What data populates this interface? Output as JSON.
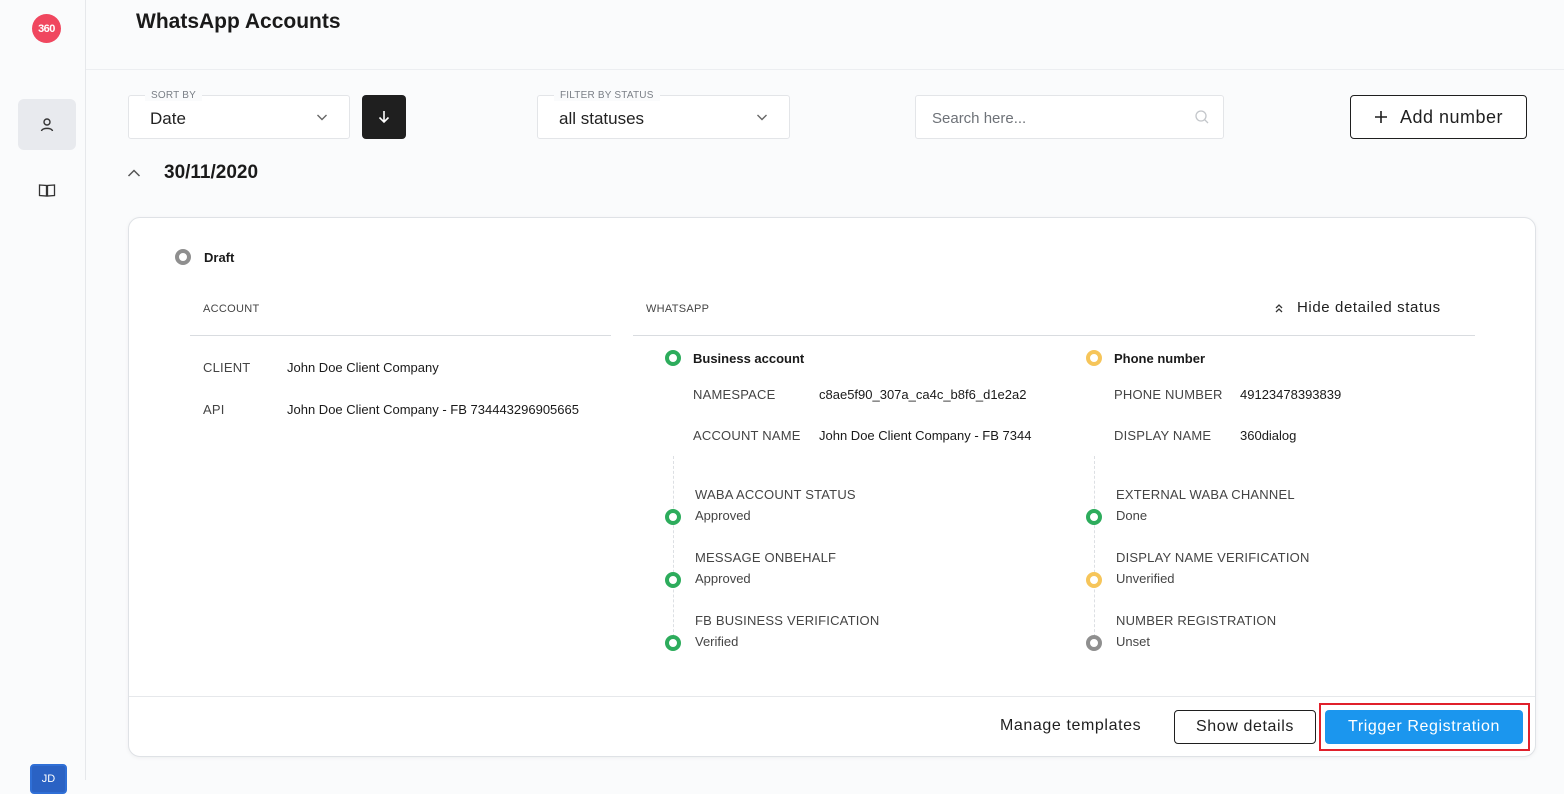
{
  "sidebar": {
    "logo": "360",
    "items": [
      {
        "name": "accounts",
        "icon": "user-icon",
        "active": true
      },
      {
        "name": "docs",
        "icon": "book-icon",
        "active": false
      }
    ],
    "avatar": "JD"
  },
  "header": {
    "title": "WhatsApp Accounts"
  },
  "filters": {
    "sort_label": "SORT BY",
    "sort_value": "Date",
    "status_label": "FILTER BY STATUS",
    "status_value": "all statuses",
    "search_placeholder": "Search here...",
    "add_number": "Add number"
  },
  "group": {
    "date": "30/11/2020"
  },
  "card": {
    "status": "Draft",
    "account": {
      "header": "ACCOUNT",
      "rows": [
        {
          "label": "CLIENT",
          "value": "John Doe Client Company"
        },
        {
          "label": "API",
          "value": "John Doe Client Company - FB 734443296905665"
        }
      ]
    },
    "whatsapp": {
      "header": "WHATSAPP",
      "hide_status": "Hide detailed status",
      "business": {
        "title": "Business account",
        "namespace_label": "NAMESPACE",
        "namespace_value": "c8ae5f90_307a_ca4c_b8f6_d1e2a2",
        "account_name_label": "ACCOUNT NAME",
        "account_name_value": "John Doe Client Company - FB 7344",
        "steps": [
          {
            "label": "WABA ACCOUNT STATUS",
            "value": "Approved",
            "status": "green"
          },
          {
            "label": "MESSAGE ONBEHALF",
            "value": "Approved",
            "status": "green"
          },
          {
            "label": "FB BUSINESS VERIFICATION",
            "value": "Verified",
            "status": "green"
          }
        ]
      },
      "phone": {
        "title": "Phone number",
        "phone_label": "PHONE NUMBER",
        "phone_value": "49123478393839",
        "display_label": "DISPLAY NAME",
        "display_value": "360dialog",
        "steps": [
          {
            "label": "EXTERNAL WABA CHANNEL",
            "value": "Done",
            "status": "green"
          },
          {
            "label": "DISPLAY NAME VERIFICATION",
            "value": "Unverified",
            "status": "yellow"
          },
          {
            "label": "NUMBER REGISTRATION",
            "value": "Unset",
            "status": "grey"
          }
        ]
      }
    },
    "footer": {
      "manage_templates": "Manage templates",
      "show_details": "Show details",
      "trigger_registration": "Trigger Registration"
    }
  },
  "colors": {
    "primary": "#1b96ee",
    "green": "#2dac5c",
    "yellow": "#f6c55a",
    "grey": "#8f8f8f",
    "highlight": "#e0202b"
  }
}
